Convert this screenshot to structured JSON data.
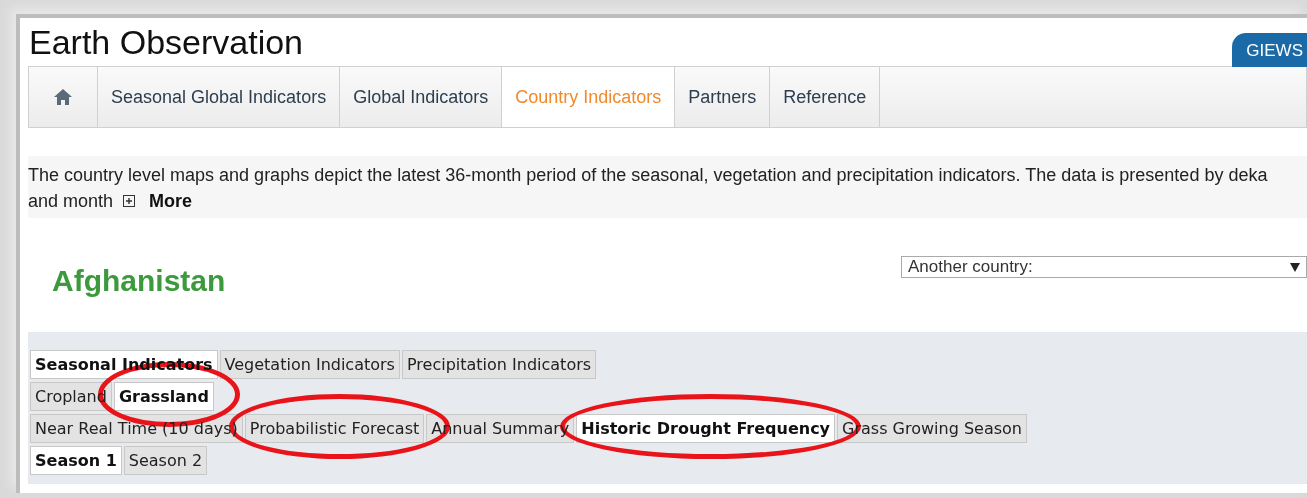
{
  "header": {
    "title": "Earth Observation",
    "badge": "GIEWS"
  },
  "nav": [
    {
      "kind": "home",
      "selected": false
    },
    {
      "kind": "text",
      "label": "Seasonal Global Indicators",
      "selected": false
    },
    {
      "kind": "text",
      "label": "Global Indicators",
      "selected": false
    },
    {
      "kind": "text",
      "label": "Country Indicators",
      "selected": true
    },
    {
      "kind": "text",
      "label": "Partners",
      "selected": false
    },
    {
      "kind": "text",
      "label": "Reference",
      "selected": false
    }
  ],
  "intro": {
    "lines": [
      "The country level maps and graphs depict the latest 36-month period of the seasonal, vegetation and precipitation indicators. The data is presented by deka",
      "and month"
    ],
    "more": "More",
    "expanded": false
  },
  "country": {
    "name": "Afghanistan",
    "select": "Another country:"
  },
  "tab_rows": [
    [
      {
        "label": "Seasonal Indicators",
        "selected": true,
        "circled": false
      },
      {
        "label": "Vegetation Indicators",
        "selected": false,
        "circled": false
      },
      {
        "label": "Precipitation Indicators",
        "selected": false,
        "circled": false
      }
    ],
    [
      {
        "label": "Cropland",
        "selected": false,
        "circled": false
      },
      {
        "label": "Grassland",
        "selected": true,
        "circled": true
      }
    ],
    [
      {
        "label": "Near Real Time (10 days)",
        "selected": false,
        "circled": false
      },
      {
        "label": "Probabilistic Forecast",
        "selected": false,
        "circled": true
      },
      {
        "label": "Annual Summary",
        "selected": false,
        "circled": false
      },
      {
        "label": "Historic Drought Frequency",
        "selected": true,
        "circled": true
      },
      {
        "label": "Grass Growing Season",
        "selected": false,
        "circled": false
      }
    ],
    [
      {
        "label": "Season 1",
        "selected": true,
        "circled": false
      },
      {
        "label": "Season 2",
        "selected": false,
        "circled": false
      }
    ]
  ]
}
